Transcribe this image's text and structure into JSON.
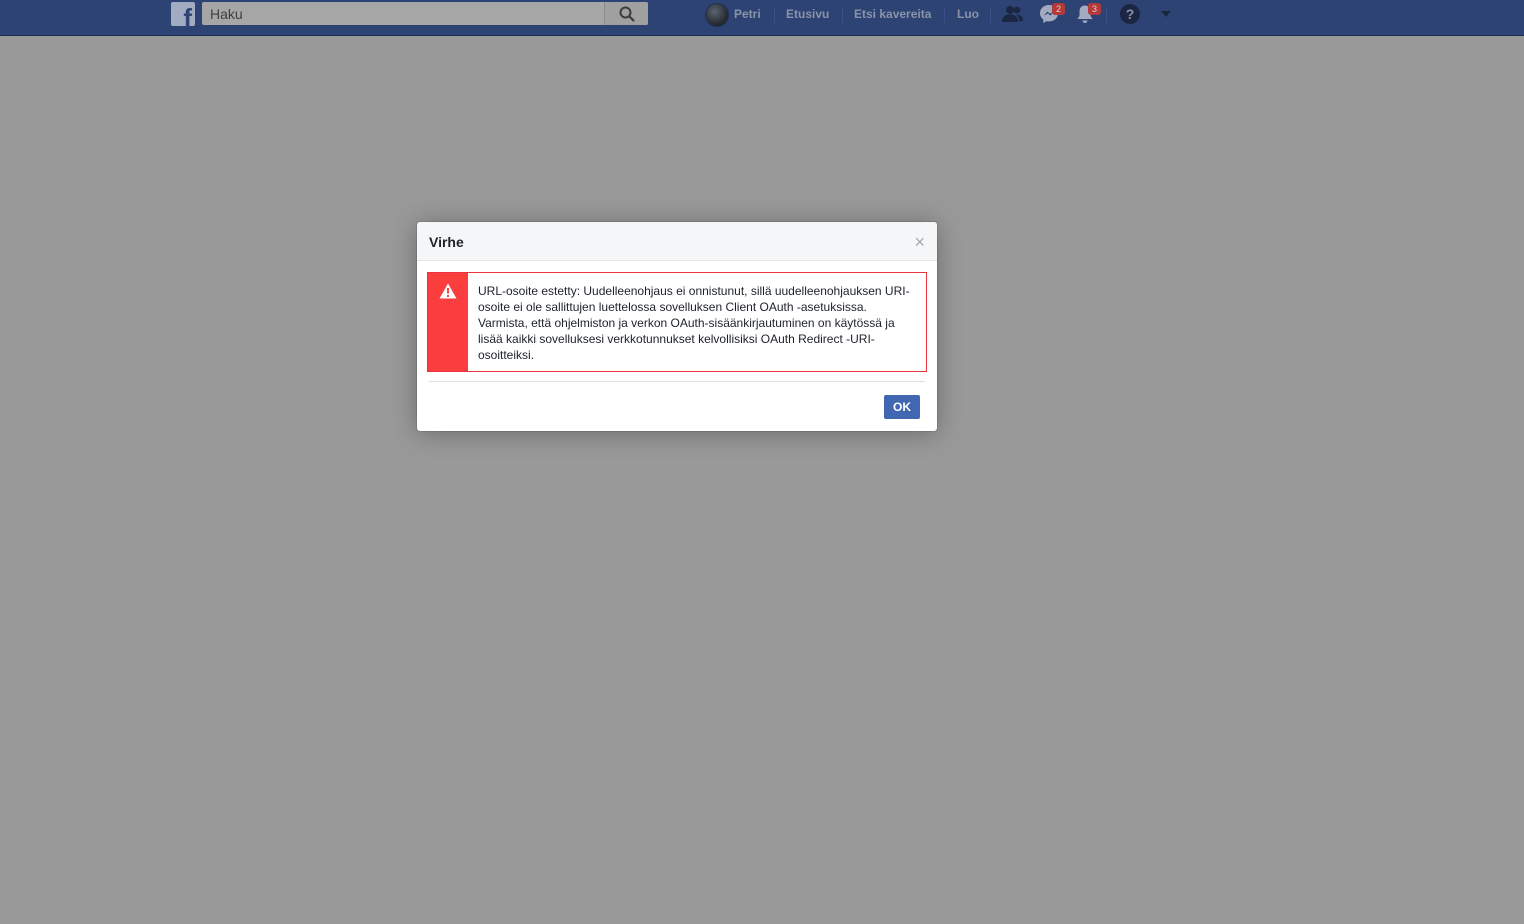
{
  "topbar": {
    "logo_letter": "f",
    "search": {
      "placeholder": "Haku"
    },
    "user_name": "Petri",
    "nav": {
      "home": "Etusivu",
      "find_friends": "Etsi kavereita",
      "create": "Luo"
    },
    "messenger_badge": "2",
    "notifications_badge": "3",
    "help_glyph": "?",
    "icons": [
      "facebook-logo-icon",
      "search-icon",
      "avatar",
      "friend-requests-icon",
      "messenger-icon",
      "notifications-icon",
      "help-icon",
      "chevron-down-icon"
    ]
  },
  "dialog": {
    "title": "Virhe",
    "close_glyph": "×",
    "message": "URL-osoite estetty: Uudelleenohjaus ei onnistunut, sillä uudelleenohjauksen URI-osoite ei ole sallittujen luettelossa sovelluksen Client OAuth -asetuksissa. Varmista, että ohjelmiston ja verkon OAuth-sisäänkirjautuminen on käytössä ja lisää kaikki sovelluksesi verkkotunnukset kelvollisiksi OAuth Redirect -URI-osoitteiksi.",
    "ok_label": "OK",
    "warning_glyph": "!"
  },
  "colors": {
    "topbar": "#2d4373",
    "overlay": "#999999",
    "error_red": "#fa3e3e",
    "button_blue": "#4267b2"
  }
}
